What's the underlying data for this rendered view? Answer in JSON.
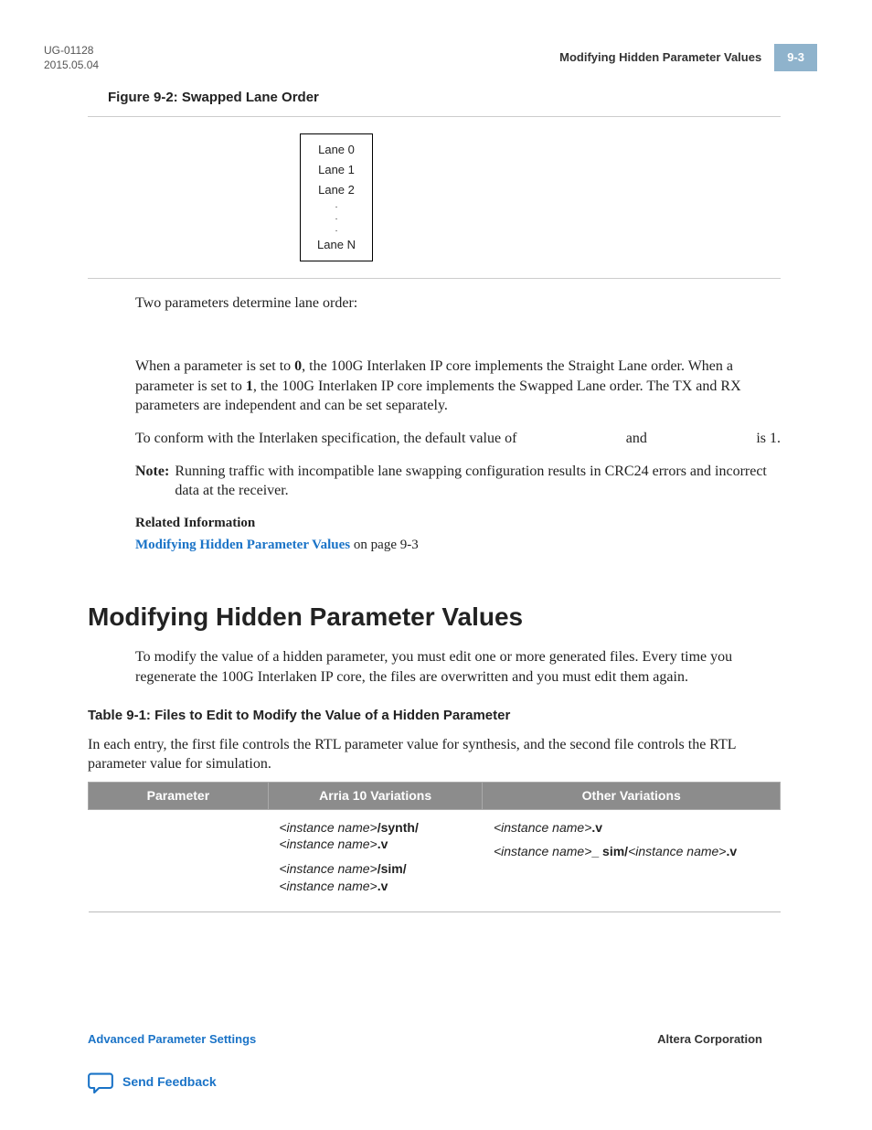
{
  "header": {
    "doc_id": "UG-01128",
    "date": "2015.05.04",
    "running_title": "Modifying Hidden Parameter Values",
    "page_num": "9-3"
  },
  "figure": {
    "caption": "Figure 9-2: Swapped Lane Order",
    "lanes": [
      "Lane 0",
      "Lane 1",
      "Lane 2",
      ".",
      ".",
      ".",
      "Lane N"
    ]
  },
  "body": {
    "p1": "Two parameters determine lane order:",
    "p2a": "When a parameter is set to ",
    "p2b_bold": "0",
    "p2c": ", the 100G Interlaken IP core implements the Straight Lane order. When a parameter is set to ",
    "p2d_bold": "1",
    "p2e": ", the 100G Interlaken IP core implements the Swapped Lane order. The TX and RX parameters are independent and can be set separately.",
    "p3a": "To conform with the Interlaken specification, the default value of ",
    "p3b": " and ",
    "p3c": " is 1.",
    "note_label": "Note:",
    "note_text": "Running traffic with incompatible lane swapping configuration results in CRC24 errors and incorrect data at the receiver."
  },
  "related": {
    "heading": "Related Information",
    "link_text": "Modifying Hidden Parameter Values",
    "suffix": " on page 9-3"
  },
  "section": {
    "title": "Modifying Hidden Parameter Values",
    "intro": "To modify the value of a hidden parameter, you must edit one or more generated files. Every time you regenerate the 100G Interlaken IP core, the files are overwritten and you must edit them again."
  },
  "table": {
    "caption": "Table 9-1: Files to Edit to Modify the Value of a Hidden Parameter",
    "desc": "In each entry, the first file controls the RTL parameter value for synthesis, and the second file controls the RTL parameter value for simulation.",
    "headers": [
      "Parameter",
      "Arria 10 Variations",
      "Other Variations"
    ],
    "row": {
      "arria": {
        "l1_a": "<instance name>",
        "l1_b": "/synth/",
        "l2_a": "<instance name>",
        "l2_b": ".v",
        "l3_a": "<instance name>",
        "l3_b": "/sim/",
        "l4_a": "<instance name>",
        "l4_b": ".v"
      },
      "other": {
        "l1_a": "<instance name>",
        "l1_b": ".v",
        "l2_a": "<instance name>",
        "l2_b": "_ sim/",
        "l2_c": "<instance name>",
        "l2_d": ".v"
      }
    }
  },
  "footer": {
    "left": "Advanced Parameter Settings",
    "right": "Altera Corporation",
    "feedback": "Send Feedback"
  }
}
